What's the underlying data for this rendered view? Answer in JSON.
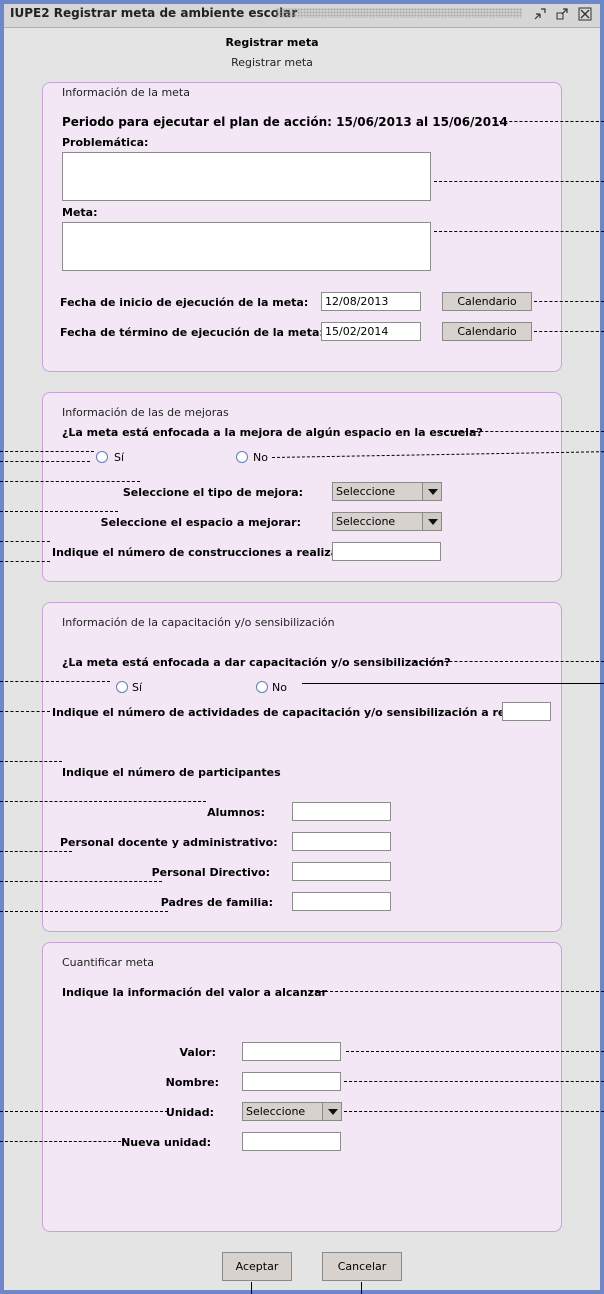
{
  "window": {
    "title": "IUPE2 Registrar meta de ambiente escolar"
  },
  "header": {
    "title": "Registrar meta",
    "subtitle": "Registrar meta"
  },
  "meta_section": {
    "title": "Información de la meta",
    "periodo": "Periodo para ejecutar el plan de acción: 15/06/2013 al 15/06/2014",
    "problematica_label": "Problemática:",
    "problematica_value": "",
    "meta_label": "Meta:",
    "meta_value": "",
    "fecha_inicio_label": "Fecha de inicio de ejecución de la meta:",
    "fecha_inicio_value": "12/08/2013",
    "fecha_termino_label": "Fecha de término de ejecución de la meta:",
    "fecha_termino_value": "15/02/2014",
    "calendar_button": "Calendario"
  },
  "mejoras_section": {
    "title": "Información de las de mejoras",
    "question": "¿La meta está enfocada a la mejora de algún espacio en la escuela?",
    "yes": "Sí",
    "no": "No",
    "tipo_label": "Seleccione el tipo de mejora:",
    "tipo_value": "Seleccione",
    "espacio_label": "Seleccione el espacio a mejorar:",
    "espacio_value": "Seleccione",
    "construcciones_label": "Indique el número de construcciones a realizar:",
    "construcciones_value": ""
  },
  "capacitacion_section": {
    "title": "Información de la capacitación y/o sensibilización",
    "question": "¿La meta está enfocada a dar capacitación y/o sensibilización?",
    "yes": "Sí",
    "no": "No",
    "actividades_label": "Indique el número de actividades de capacitación y/o sensibilización a realizar:",
    "actividades_value": "",
    "participantes_label": "Indique el número de participantes",
    "alumnos_label": "Alumnos:",
    "docente_label": "Personal docente y administrativo:",
    "directivo_label": "Personal Directivo:",
    "padres_label": "Padres de familia:"
  },
  "cuantificar_section": {
    "title": "Cuantificar meta",
    "info": "Indique la información del valor a alcanzar",
    "valor_label": "Valor:",
    "nombre_label": "Nombre:",
    "unidad_label": "Unidad:",
    "unidad_value": "Seleccione",
    "nueva_label": "Nueva unidad:"
  },
  "footer": {
    "accept": "Aceptar",
    "cancel": "Cancelar"
  },
  "colors": {
    "frame": "#6d87c9",
    "panel_bg": "#f3e7f6",
    "panel_border": "#c9a3d6"
  },
  "icons": [
    "minimize-icon",
    "maximize-icon",
    "close-icon"
  ]
}
